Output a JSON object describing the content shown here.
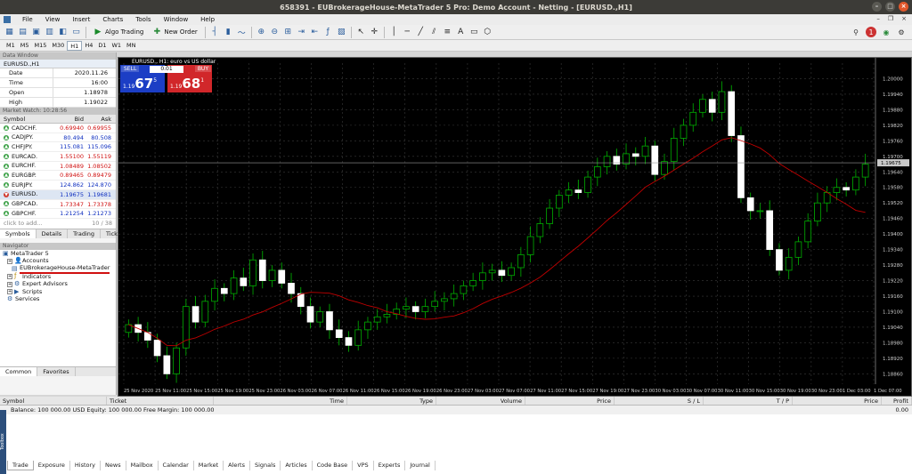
{
  "window": {
    "title": "658391 - EUBrokerageHouse-MetaTrader 5 Pro: Demo Account - Netting - [EURUSD.,H1]"
  },
  "menu": [
    "File",
    "View",
    "Insert",
    "Charts",
    "Tools",
    "Window",
    "Help"
  ],
  "toolbar": {
    "algo_label": "Algo Trading",
    "new_order_label": "New Order"
  },
  "timeframes": [
    "M1",
    "M5",
    "M15",
    "M30",
    "H1",
    "H4",
    "D1",
    "W1",
    "MN"
  ],
  "active_timeframe": "H1",
  "data_window": {
    "title": "Data Window",
    "symbol": "EURUSD.,H1",
    "rows": [
      {
        "k": "Date",
        "v": "2020.11.26"
      },
      {
        "k": "Time",
        "v": "16:00"
      },
      {
        "k": "Open",
        "v": "1.18978"
      },
      {
        "k": "High",
        "v": "1.19022"
      }
    ]
  },
  "market_watch": {
    "title": "Market Watch: 10:28:56",
    "headers": [
      "Symbol",
      "Bid",
      "Ask"
    ],
    "rows": [
      {
        "symbol": "CADCHF.",
        "bid": "0.69940",
        "ask": "0.69955",
        "dir": "up",
        "color": "red"
      },
      {
        "symbol": "CADJPY.",
        "bid": "80.494",
        "ask": "80.508",
        "dir": "up",
        "color": "blue"
      },
      {
        "symbol": "CHFJPY.",
        "bid": "115.081",
        "ask": "115.096",
        "dir": "up",
        "color": "blue"
      },
      {
        "symbol": "EURCAD.",
        "bid": "1.55100",
        "ask": "1.55119",
        "dir": "up",
        "color": "red"
      },
      {
        "symbol": "EURCHF.",
        "bid": "1.08489",
        "ask": "1.08502",
        "dir": "up",
        "color": "red"
      },
      {
        "symbol": "EURGBP.",
        "bid": "0.89465",
        "ask": "0.89479",
        "dir": "up",
        "color": "red"
      },
      {
        "symbol": "EURJPY.",
        "bid": "124.862",
        "ask": "124.870",
        "dir": "up",
        "color": "blue"
      },
      {
        "symbol": "EURUSD.",
        "bid": "1.19675",
        "ask": "1.19681",
        "dir": "dn",
        "color": "blue"
      },
      {
        "symbol": "GBPCAD.",
        "bid": "1.73347",
        "ask": "1.73378",
        "dir": "up",
        "color": "red"
      },
      {
        "symbol": "GBPCHF.",
        "bid": "1.21254",
        "ask": "1.21273",
        "dir": "up",
        "color": "blue"
      }
    ],
    "add_placeholder": "click to add...",
    "count": "10 / 38",
    "tabs": [
      "Symbols",
      "Details",
      "Trading",
      "Ticks"
    ]
  },
  "navigator": {
    "title": "Navigator",
    "items": [
      {
        "label": "MetaTrader 5",
        "level": 0
      },
      {
        "label": "Accounts",
        "level": 1
      },
      {
        "label": "EUBrokerageHouse-MetaTrader",
        "level": 2
      },
      {
        "label": "Indicators",
        "level": 1
      },
      {
        "label": "Expert Advisors",
        "level": 1
      },
      {
        "label": "Scripts",
        "level": 1
      },
      {
        "label": "Services",
        "level": 1
      }
    ],
    "tabs": [
      "Common",
      "Favorites"
    ]
  },
  "trade_panel": {
    "sell": "SELL",
    "buy": "BUY",
    "qty": "0.01",
    "sell_prefix": "1.19",
    "sell_big": "67",
    "sell_sup": "5",
    "buy_prefix": "1.19",
    "buy_big": "68",
    "buy_sup": "1"
  },
  "chart_title": "EURUSD., H1: euro vs US dollar",
  "chart_data": {
    "type": "candlestick",
    "yticks": [
      "1.20000",
      "1.19940",
      "1.19880",
      "1.19820",
      "1.19760",
      "1.19700",
      "1.19640",
      "1.19580",
      "1.19520",
      "1.19460",
      "1.19400",
      "1.19340",
      "1.19280",
      "1.19220",
      "1.19160",
      "1.19100",
      "1.19040",
      "1.18980",
      "1.18920",
      "1.18860"
    ],
    "ylim": [
      1.1882,
      1.2006
    ],
    "current_price": "1.19675",
    "current_price_value": 1.19675,
    "xticks": [
      "25 Nov 2020",
      "25 Nov 11:00",
      "25 Nov 15:00",
      "25 Nov 19:00",
      "25 Nov 23:00",
      "26 Nov 03:00",
      "26 Nov 07:00",
      "26 Nov 11:00",
      "26 Nov 15:00",
      "26 Nov 19:00",
      "26 Nov 23:00",
      "27 Nov 03:00",
      "27 Nov 07:00",
      "27 Nov 11:00",
      "27 Nov 15:00",
      "27 Nov 19:00",
      "27 Nov 23:00",
      "30 Nov 03:00",
      "30 Nov 07:00",
      "30 Nov 11:00",
      "30 Nov 15:00",
      "30 Nov 19:00",
      "30 Nov 23:00",
      "1 Dec 03:00",
      "1 Dec 07:00"
    ],
    "close": [
      1.1905,
      1.1902,
      1.1899,
      1.1893,
      1.1886,
      1.1896,
      1.1912,
      1.1906,
      1.1914,
      1.1919,
      1.1917,
      1.1923,
      1.192,
      1.193,
      1.1922,
      1.1926,
      1.1921,
      1.1917,
      1.1912,
      1.1906,
      1.191,
      1.1903,
      1.19,
      1.1897,
      1.1903,
      1.1906,
      1.1908,
      1.1909,
      1.1911,
      1.1912,
      1.191,
      1.1912,
      1.1914,
      1.1915,
      1.1917,
      1.192,
      1.1922,
      1.1925,
      1.1926,
      1.1924,
      1.1927,
      1.1932,
      1.1939,
      1.1944,
      1.195,
      1.1955,
      1.1957,
      1.1956,
      1.1962,
      1.1966,
      1.197,
      1.1967,
      1.1971,
      1.197,
      1.1974,
      1.1963,
      1.1968,
      1.1977,
      1.1982,
      1.1987,
      1.1992,
      1.1987,
      1.1995,
      1.1978,
      1.1954,
      1.1949,
      1.1949,
      1.1934,
      1.1926,
      1.1931,
      1.1937,
      1.1945,
      1.1952,
      1.1956,
      1.1958,
      1.1957,
      1.1962,
      1.1967
    ],
    "ma_label": "moving average (red)"
  },
  "bottom": {
    "headers": [
      "Symbol",
      "Ticket",
      "Time",
      "Type",
      "Volume",
      "Price",
      "S / L",
      "T / P",
      "Price",
      "Profit"
    ],
    "balance": "Balance: 100 000.00 USD  Equity: 100 000.00  Free Margin: 100 000.00",
    "profit": "0.00",
    "tabs": [
      "Trade",
      "Exposure",
      "History",
      "News",
      "Mailbox",
      "Calendar",
      "Market",
      "Alerts",
      "Signals",
      "Articles",
      "Code Base",
      "VPS",
      "Experts",
      "Journal"
    ],
    "side_label": "Toolbox"
  },
  "colors": {
    "bull": "#00b000",
    "bear": "#ffffff",
    "ma": "#c00000",
    "grid": "#2a2a2a",
    "sell": "#1c3ec5",
    "buy": "#d1272a"
  }
}
